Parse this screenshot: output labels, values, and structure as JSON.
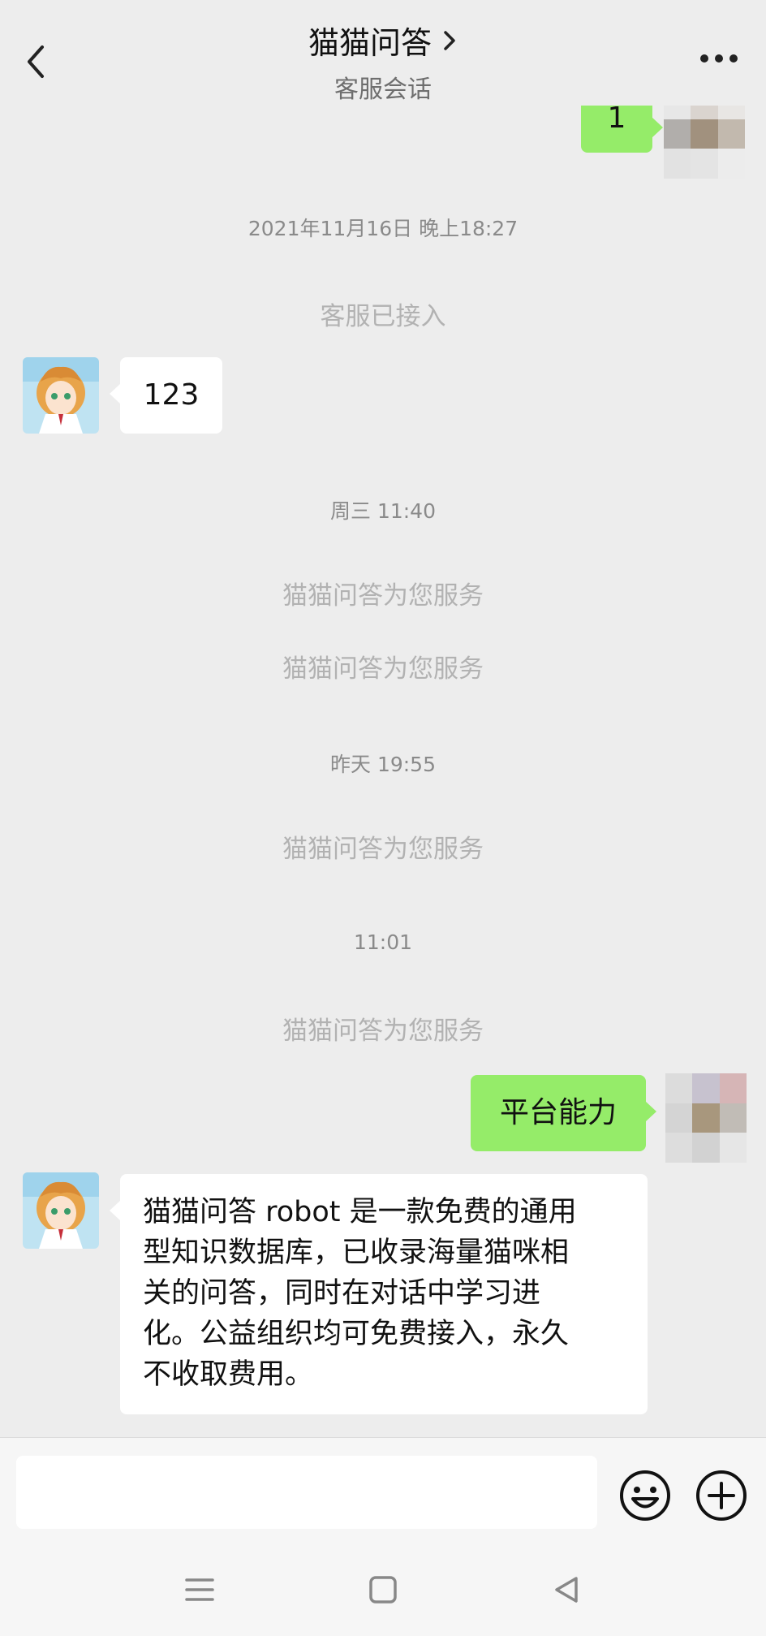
{
  "header": {
    "title": "猫猫问答",
    "subtitle": "客服会话"
  },
  "messages": {
    "top_partial_text": "1",
    "timestamp_1": "2021年11月16日 晚上18:27",
    "system_connected": "客服已接入",
    "reply_123": "123",
    "timestamp_2": "周三 11:40",
    "service_1": "猫猫问答为您服务",
    "service_2": "猫猫问答为您服务",
    "timestamp_3": "昨天 19:55",
    "service_3": "猫猫问答为您服务",
    "timestamp_4": "11:01",
    "service_4": "猫猫问答为您服务",
    "user_question": "平台能力",
    "bot_answer_lines": [
      "猫猫问答 robot 是一款免费的通用",
      "型知识数据库，已收录海量猫咪相",
      "关的问答，同时在对话中学习进",
      "化。公益组织均可免费接入，永久",
      "不收取费用。"
    ]
  },
  "input": {
    "value": ""
  },
  "colors": {
    "background": "#ededed",
    "user_bubble": "#95ec69",
    "bot_bubble": "#ffffff",
    "system_text": "#b2b2b2"
  },
  "icons": {
    "back": "chevron-left-icon",
    "title_arrow": "chevron-right-icon",
    "more": "more-dots-icon",
    "emoji": "emoji-icon",
    "plus": "plus-icon",
    "nav_menu": "menu-icon",
    "nav_home": "home-icon",
    "nav_back": "back-triangle-icon"
  }
}
